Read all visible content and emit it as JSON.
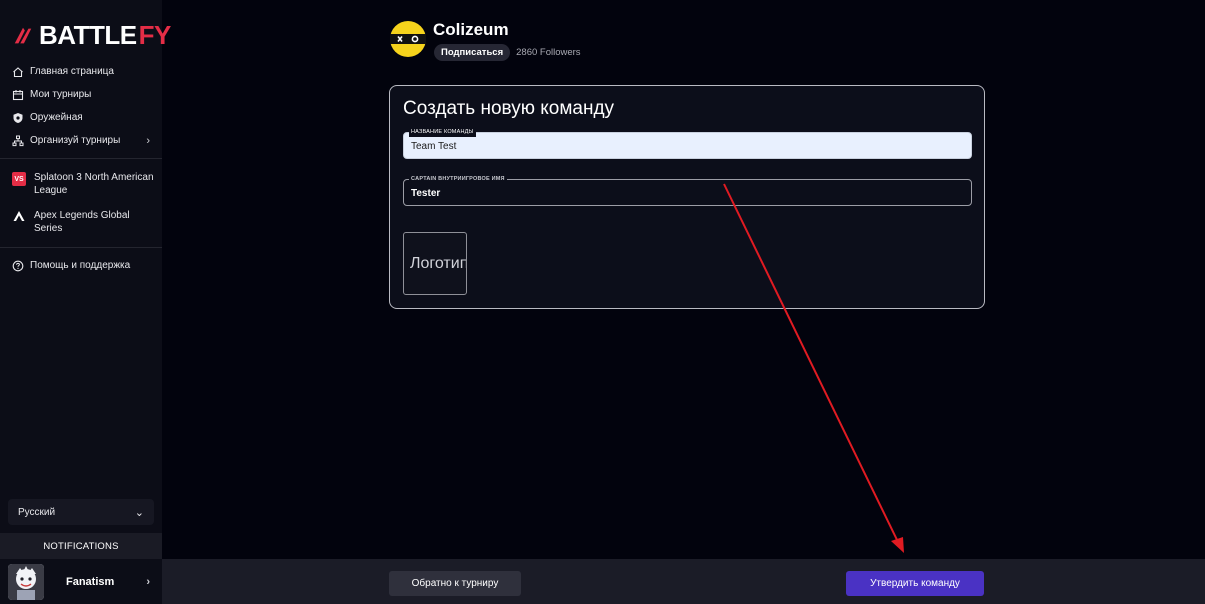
{
  "brand": {
    "part1": "BATTLE",
    "part2": "FY"
  },
  "sidebar": {
    "items": [
      {
        "label": "Главная страница",
        "icon": "home-icon"
      },
      {
        "label": "Мои турниры",
        "icon": "calendar-icon"
      },
      {
        "label": "Оружейная",
        "icon": "shield-icon"
      },
      {
        "label": "Организуй турниры",
        "icon": "org-chart-icon"
      }
    ],
    "leagues": [
      {
        "label": "Splatoon 3 North American League",
        "badge": "VS"
      },
      {
        "label": "Apex Legends Global Series"
      }
    ],
    "help": "Помощь и поддержка",
    "language": "Русский",
    "notifications": "NOTIFICATIONS",
    "user": {
      "name": "Fanatism"
    }
  },
  "org": {
    "name": "Colizeum",
    "subscribe": "Подписаться",
    "followers": "2860 Followers"
  },
  "form": {
    "title": "Создать новую команду",
    "team_name_label": "НАЗВАНИЕ КОМАНДЫ",
    "team_name_value": "Team Test",
    "captain_label": "CAPTAIN ВНУТРИИГРОВОЕ ИМЯ",
    "captain_value": "Tester",
    "logo_label": "Логотип"
  },
  "footer": {
    "back_label": "Обратно к турниру",
    "confirm_label": "Утвердить команду"
  },
  "colors": {
    "accent": "#4a32c4",
    "brand_red": "#e42d46",
    "arrow": "#e01b22"
  }
}
